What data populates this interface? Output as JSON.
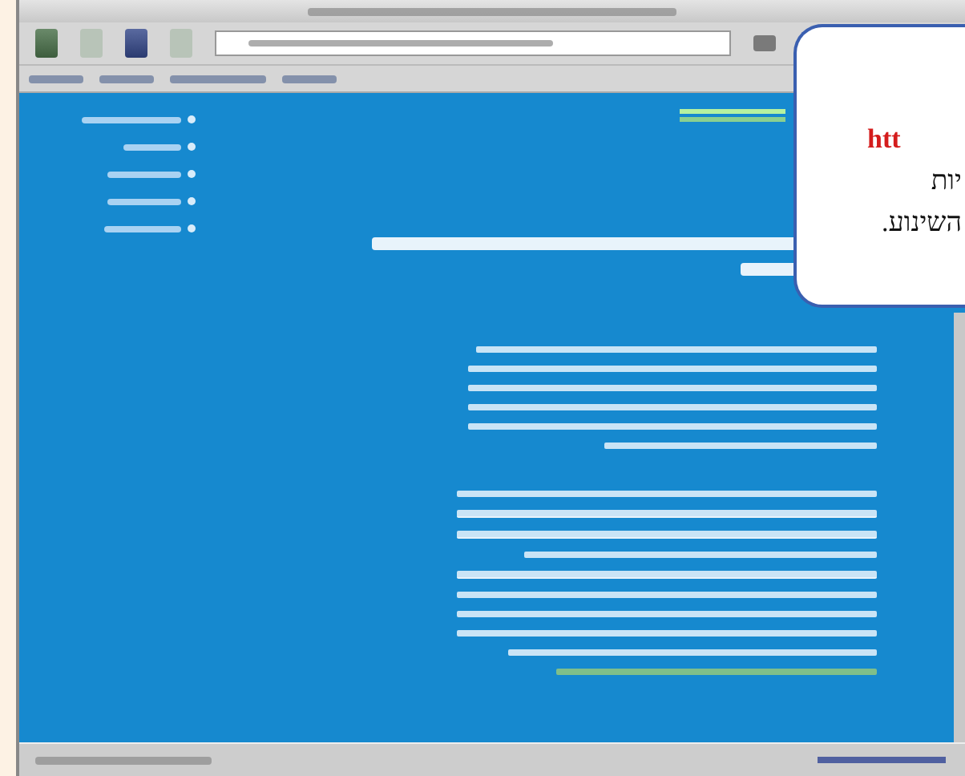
{
  "callout": {
    "lines": [
      {
        "text": "htt",
        "kind": "url"
      },
      {
        "text": "יות",
        "kind": "plain"
      },
      {
        "text": "השינוע.",
        "kind": "plain"
      }
    ]
  }
}
